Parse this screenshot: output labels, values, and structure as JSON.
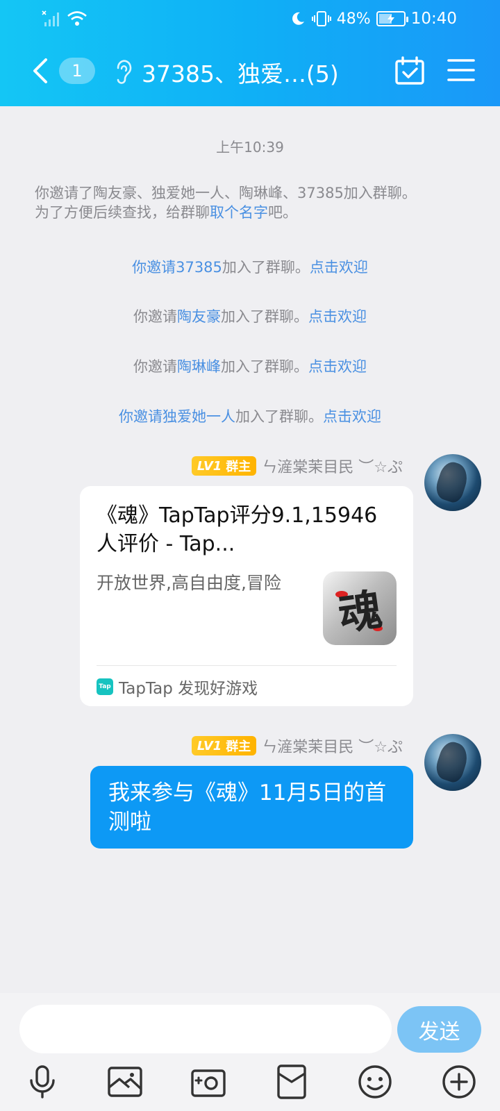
{
  "status_bar": {
    "battery": "48%",
    "time": "10:40"
  },
  "header": {
    "unread_count": "1",
    "title": "37385、独爱…(5)"
  },
  "timestamp": "上午10:39",
  "system_notice": {
    "line1": "你邀请了陶友豪、独爱她一人、陶琳峰、37385加入群聊。",
    "line2_pre": "为了方便后续查找，给群聊",
    "line2_link": "取个名字",
    "line2_post": "吧。"
  },
  "invites": [
    {
      "prefix": "你邀请",
      "name": "37385",
      "suffix": "加入了群聊。",
      "action": "点击欢迎"
    },
    {
      "prefix": "你邀请",
      "name": "陶友豪",
      "suffix": "加入了群聊。",
      "action": "点击欢迎"
    },
    {
      "prefix": "你邀请",
      "name": "陶琳峰",
      "suffix": "加入了群聊。",
      "action": "点击欢迎"
    },
    {
      "prefix": "你邀请",
      "name": "独爱她一人",
      "suffix": "加入了群聊。",
      "action": "点击欢迎"
    }
  ],
  "messages": [
    {
      "sender": {
        "level": "LV1",
        "role": "群主",
        "name": "ㄣ滻棠茉目民 ︶☆ぷ"
      },
      "card": {
        "title": "《魂》TapTap评分9.1,15946 人评价 - Tap...",
        "description": "开放世界,高自由度,冒险",
        "thumb_glyph": "魂",
        "source_logo": "Tap",
        "source": "TapTap 发现好游戏"
      }
    },
    {
      "sender": {
        "level": "LV1",
        "role": "群主",
        "name": "ㄣ滻棠茉目民 ︶☆ぷ"
      },
      "text": "我来参与《魂》11月5日的首测啦"
    }
  ],
  "input": {
    "placeholder": "",
    "send_label": "发送"
  },
  "toolbar": [
    "mic-icon",
    "image-icon",
    "camera-icon",
    "red-packet-icon",
    "emoji-icon",
    "plus-icon"
  ]
}
